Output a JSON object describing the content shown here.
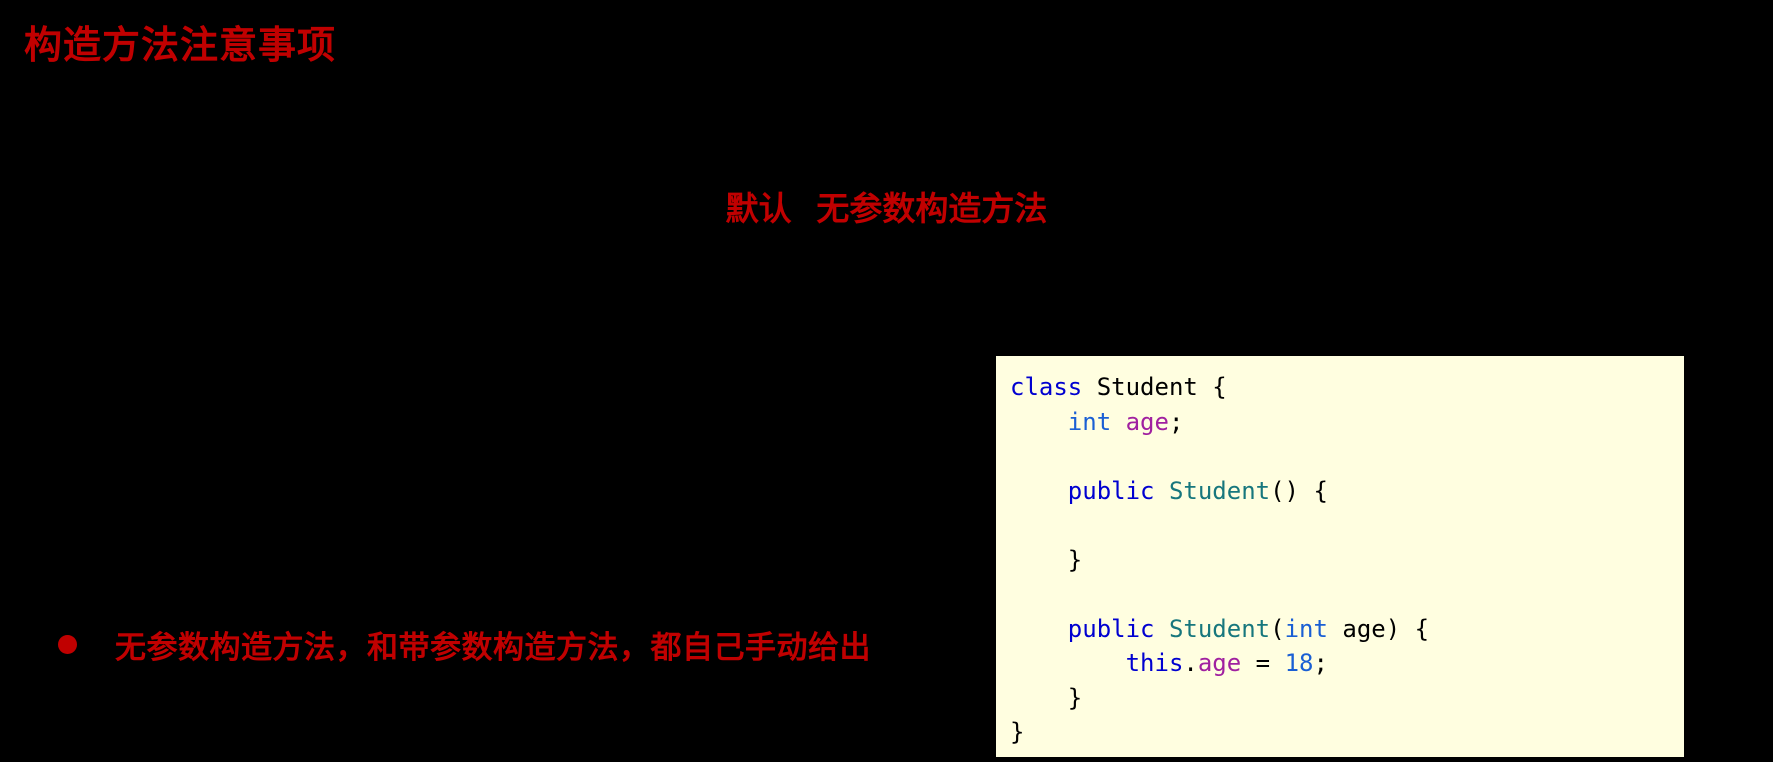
{
  "slide": {
    "background_color": "#000000",
    "title": "构造方法注意事项",
    "title_color": "#c00000",
    "center_heading": "默认   无参数构造方法",
    "heading_color": "#c00000"
  },
  "bullet": {
    "marker": "●",
    "text": "无参数构造方法，和带参数构造方法，都自己手动给出",
    "color": "#c00000"
  },
  "code_panel": {
    "background_color": "#fffee0",
    "language": "java",
    "lines": [
      [
        {
          "t": "class",
          "c": "kw"
        },
        {
          "t": " ",
          "c": "plain"
        },
        {
          "t": "Student",
          "c": "class"
        },
        {
          "t": " {",
          "c": "plain"
        }
      ],
      [
        {
          "t": "    ",
          "c": "plain"
        },
        {
          "t": "int",
          "c": "type"
        },
        {
          "t": " ",
          "c": "plain"
        },
        {
          "t": "age",
          "c": "field"
        },
        {
          "t": ";",
          "c": "plain"
        }
      ],
      [
        {
          "t": "",
          "c": "plain"
        }
      ],
      [
        {
          "t": "    ",
          "c": "plain"
        },
        {
          "t": "public",
          "c": "kw"
        },
        {
          "t": " ",
          "c": "plain"
        },
        {
          "t": "Student",
          "c": "ctor"
        },
        {
          "t": "() {",
          "c": "plain"
        }
      ],
      [
        {
          "t": "",
          "c": "plain"
        }
      ],
      [
        {
          "t": "    }",
          "c": "plain"
        }
      ],
      [
        {
          "t": "",
          "c": "plain"
        }
      ],
      [
        {
          "t": "    ",
          "c": "plain"
        },
        {
          "t": "public",
          "c": "kw"
        },
        {
          "t": " ",
          "c": "plain"
        },
        {
          "t": "Student",
          "c": "ctor"
        },
        {
          "t": "(",
          "c": "plain"
        },
        {
          "t": "int",
          "c": "type"
        },
        {
          "t": " age) {",
          "c": "plain"
        }
      ],
      [
        {
          "t": "        ",
          "c": "plain"
        },
        {
          "t": "this",
          "c": "kw"
        },
        {
          "t": ".",
          "c": "plain"
        },
        {
          "t": "age",
          "c": "field"
        },
        {
          "t": " = ",
          "c": "plain"
        },
        {
          "t": "18",
          "c": "num"
        },
        {
          "t": ";",
          "c": "plain"
        }
      ],
      [
        {
          "t": "    }",
          "c": "plain"
        }
      ],
      [
        {
          "t": "}",
          "c": "plain"
        }
      ]
    ]
  }
}
